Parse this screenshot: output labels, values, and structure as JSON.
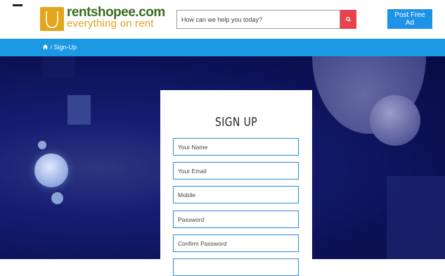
{
  "header": {
    "logo": {
      "name": "rentshopee.com",
      "tagline": "everything on rent",
      "brand_color": "#3a6d22",
      "accent_color": "#e0a31a",
      "icon": "shopping-bag-icon"
    },
    "menu_icon": "hamburger-menu-icon",
    "search": {
      "placeholder": "How can we help you today?",
      "button_icon": "search-icon",
      "button_color": "#e8424b"
    },
    "post_button": {
      "label": "Post Free Ad",
      "color": "#1d93e8"
    }
  },
  "breadcrumb": {
    "home_icon": "home-icon",
    "separator": "/",
    "current": "Sign-Up",
    "bar_color": "#1b98e4"
  },
  "signup": {
    "title": "SIGN UP",
    "fields": {
      "name_placeholder": "Your Name",
      "email_placeholder": "Your Email",
      "mobile_placeholder": "Mobile",
      "password_placeholder": "Password",
      "confirm_password_placeholder": "Confirm Password"
    },
    "field_border_color": "#2f8de0"
  },
  "hero": {
    "background_color": "#0c1155"
  }
}
